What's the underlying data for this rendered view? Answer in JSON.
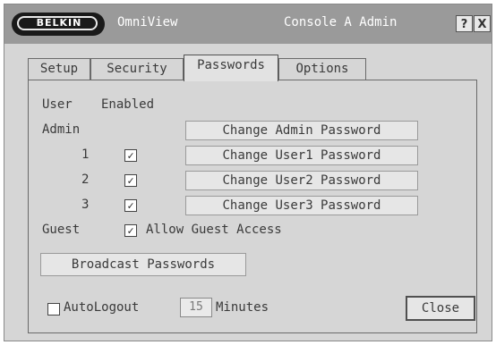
{
  "title_bar": {
    "logo_text": "BELKIN",
    "app_name": "OmniView",
    "console_name": "Console A Admin",
    "help_label": "?",
    "close_label": "X"
  },
  "tabs": [
    {
      "label": "Setup"
    },
    {
      "label": "Security"
    },
    {
      "label": "Passwords"
    },
    {
      "label": "Options"
    }
  ],
  "active_tab": "Passwords",
  "passwords": {
    "user_header": "User",
    "enabled_header": "Enabled",
    "admin_label": "Admin",
    "users": [
      {
        "label": "1",
        "enabled": true,
        "button": "Change User1 Password"
      },
      {
        "label": "2",
        "enabled": true,
        "button": "Change User2 Password"
      },
      {
        "label": "3",
        "enabled": true,
        "button": "Change User3 Password"
      }
    ],
    "admin_button": "Change Admin Password",
    "guest_label": "Guest",
    "guest_allowed": true,
    "guest_access_label": "Allow Guest Access",
    "broadcast_button": "Broadcast Passwords"
  },
  "autologout": {
    "checked": false,
    "label": "AutoLogout",
    "minutes_value": "15",
    "minutes_label": "Minutes"
  },
  "close_button": "Close",
  "checkbox_mark": "✓",
  "colors": {
    "title_bar": "#9a9a9a",
    "panel": "#d6d6d6"
  }
}
